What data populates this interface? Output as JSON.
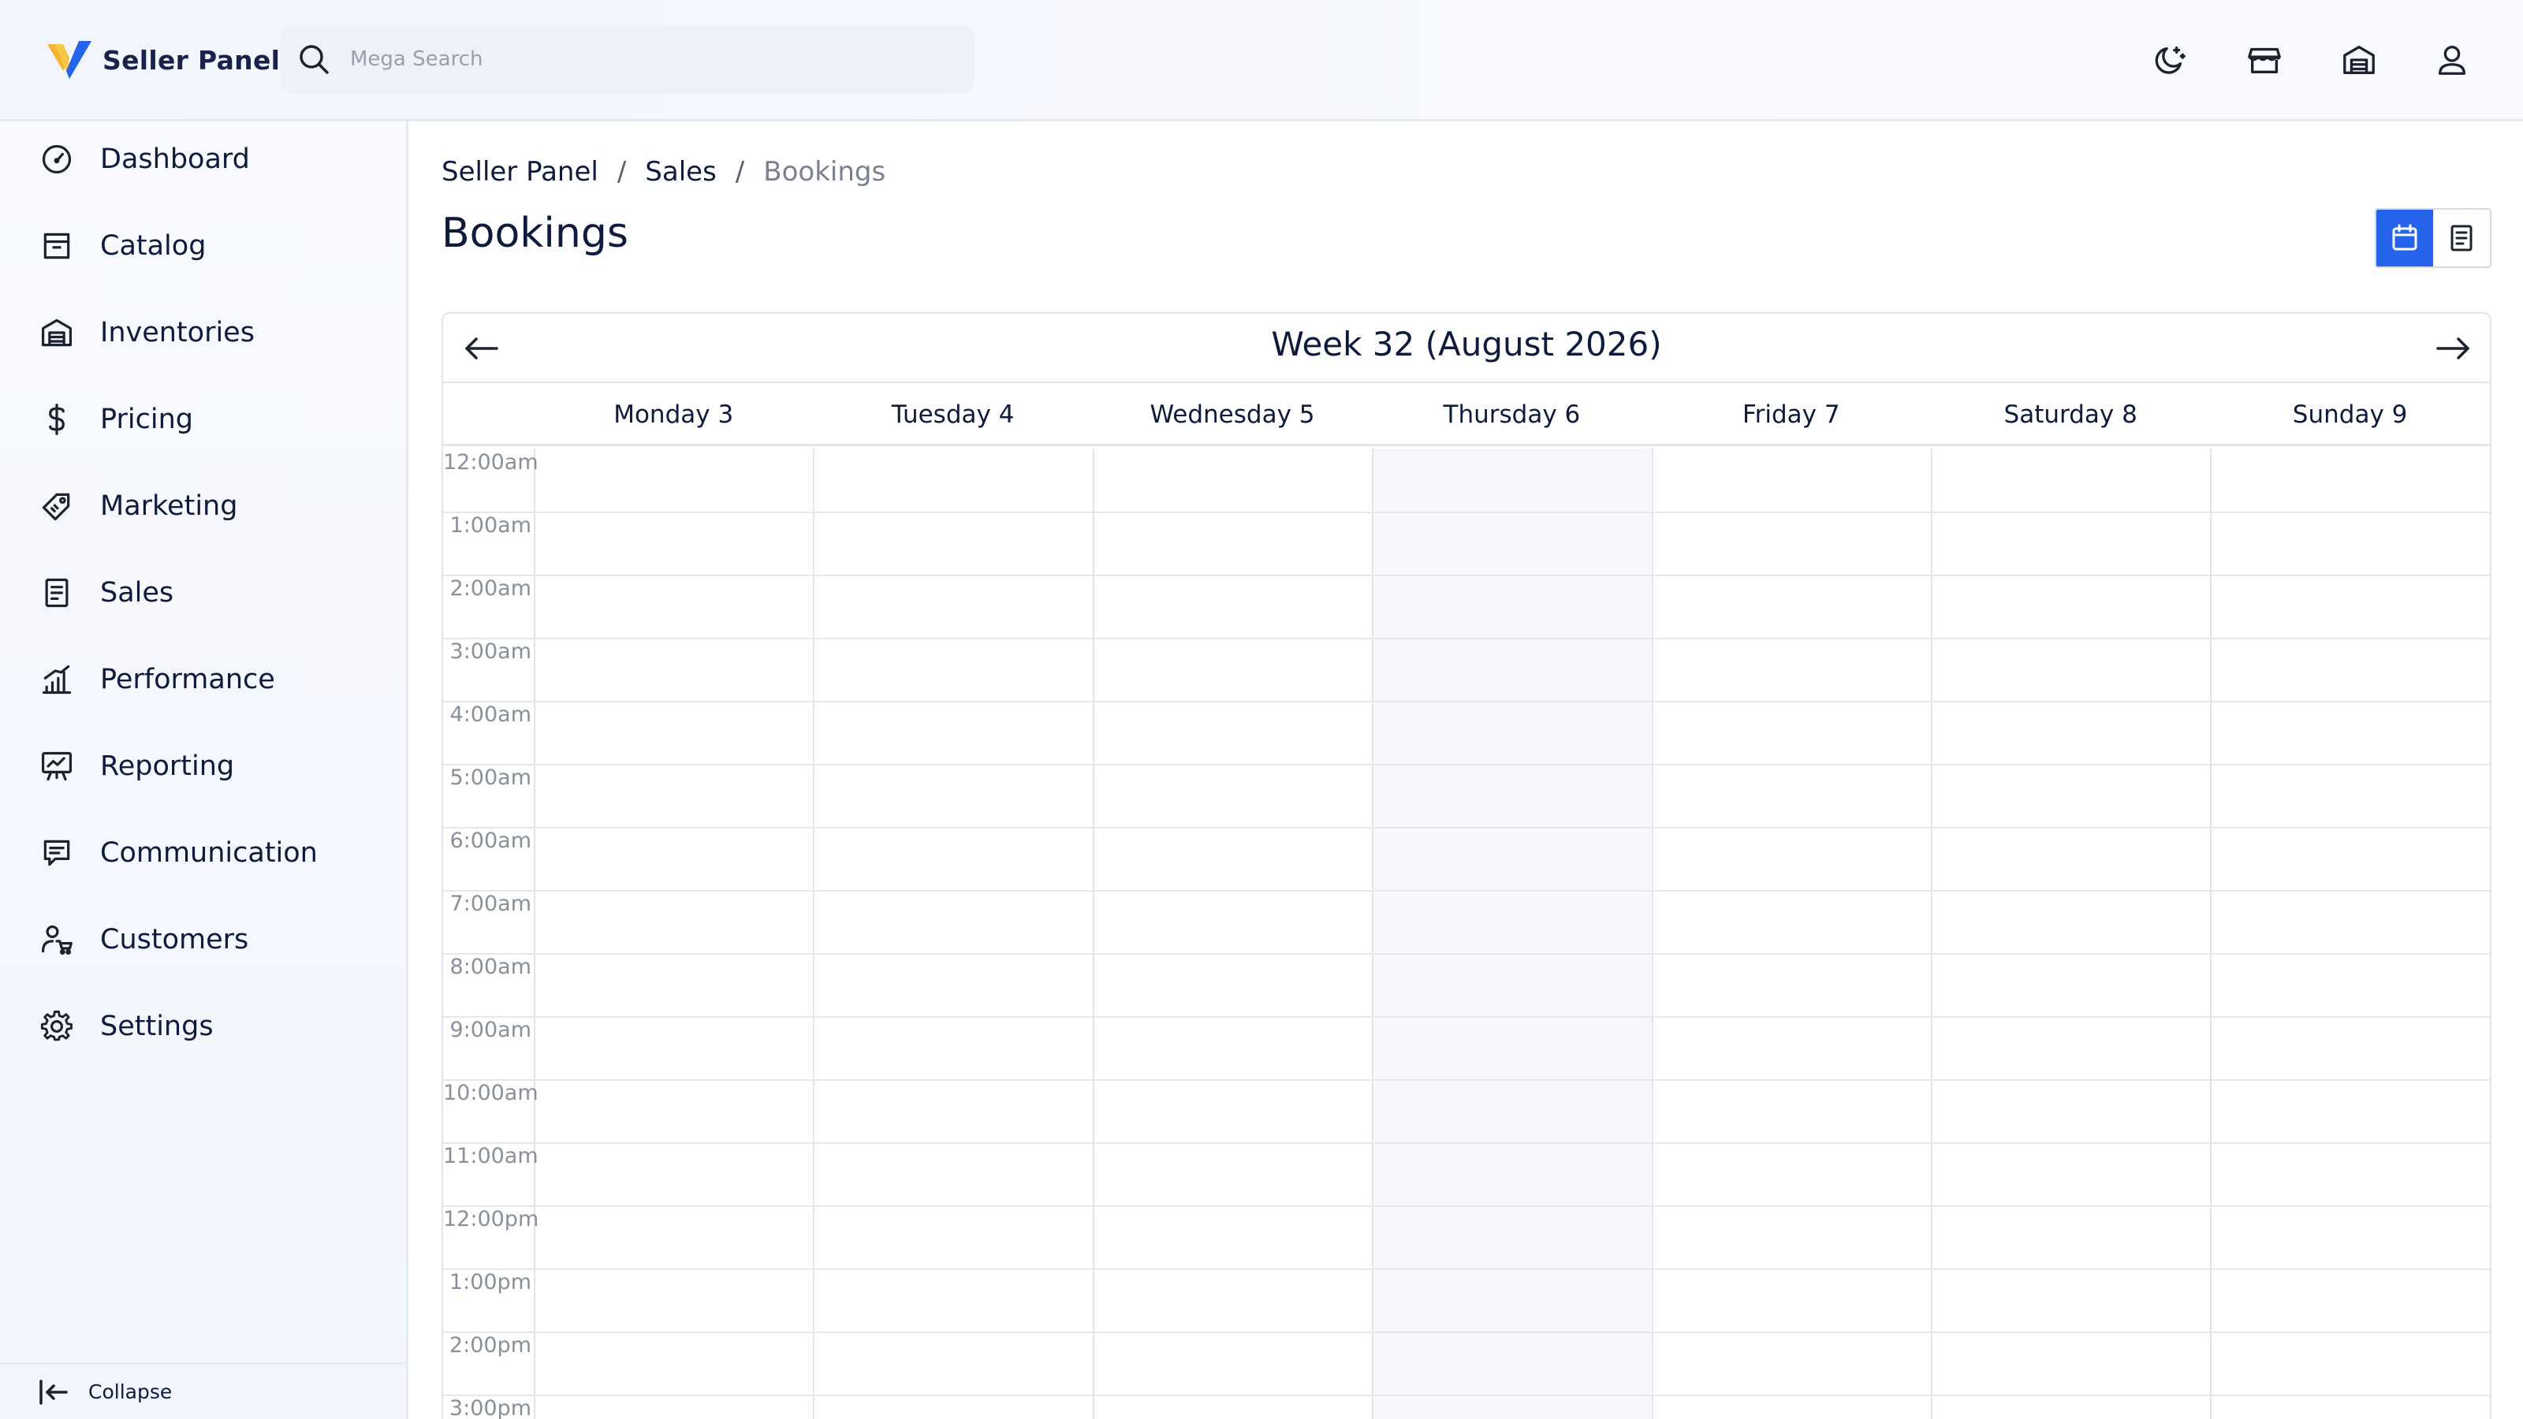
{
  "header": {
    "brand_name": "Seller Panel",
    "search_placeholder": "Mega Search",
    "icons": [
      "moon-icon",
      "store-icon",
      "warehouse-icon",
      "user-icon"
    ]
  },
  "sidebar": {
    "items": [
      {
        "label": "Dashboard",
        "icon": "speedometer-icon"
      },
      {
        "label": "Catalog",
        "icon": "catalog-icon"
      },
      {
        "label": "Inventories",
        "icon": "warehouse-icon"
      },
      {
        "label": "Pricing",
        "icon": "dollar-icon"
      },
      {
        "label": "Marketing",
        "icon": "tag-icon"
      },
      {
        "label": "Sales",
        "icon": "receipt-icon"
      },
      {
        "label": "Performance",
        "icon": "bar-chart-icon"
      },
      {
        "label": "Reporting",
        "icon": "presentation-icon"
      },
      {
        "label": "Communication",
        "icon": "chat-icon"
      },
      {
        "label": "Customers",
        "icon": "customer-cart-icon"
      },
      {
        "label": "Settings",
        "icon": "gear-icon"
      }
    ],
    "collapse_label": "Collapse"
  },
  "breadcrumb": [
    "Seller Panel",
    "Sales",
    "Bookings"
  ],
  "page_title": "Bookings",
  "view_toggle": {
    "active": "calendar",
    "options": [
      "calendar-icon",
      "list-icon"
    ]
  },
  "colors": {
    "accent": "#2563eb",
    "today_bg": "#f7f8fd",
    "text": "#0f1b3d"
  },
  "calendar": {
    "title": "Week 32 (August 2026)",
    "today_index": 3,
    "days": [
      "Monday 3",
      "Tuesday 4",
      "Wednesday 5",
      "Thursday 6",
      "Friday 7",
      "Saturday 8",
      "Sunday 9"
    ],
    "times": [
      "12:00am",
      "1:00am",
      "2:00am",
      "3:00am",
      "4:00am",
      "5:00am",
      "6:00am",
      "7:00am",
      "8:00am",
      "9:00am",
      "10:00am",
      "11:00am",
      "12:00pm",
      "1:00pm",
      "2:00pm",
      "3:00pm"
    ]
  }
}
